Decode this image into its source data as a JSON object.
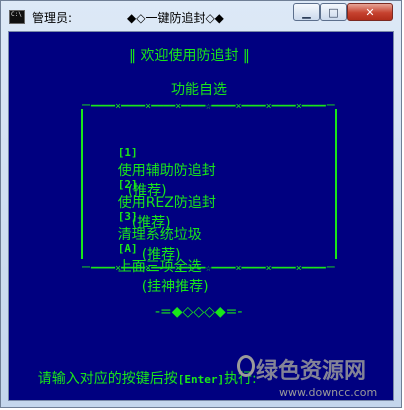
{
  "window": {
    "icon_label": "C:\\",
    "title_left": "管理员:",
    "title_center": "◆◇一键防追封◇◆",
    "controls": {
      "minimize": "▁",
      "maximize": "□",
      "close": "✕"
    }
  },
  "console": {
    "banner": "‖ 欢迎使用防追封 ‖",
    "section_title": "功能自选",
    "rule_top": "ー━━━━×━━━━×━━━━×━━━━☆━━━━×━━━━×━━━━×━━━━ー",
    "rule_bottom": "ー━━━━×━━━━×━━━━×━━━━☆━━━━×━━━━×━━━━×━━━━ー",
    "menu": [
      {
        "key": "[1]",
        "label": "使用辅助防追封",
        "tag": "(推荐)"
      },
      {
        "key": "[2]",
        "label": "使用REZ防追封",
        "tag": "(推荐)"
      },
      {
        "key": "[3]",
        "label": "清理系统垃圾",
        "tag": "(推荐)"
      },
      {
        "key": "[A]",
        "label": "上面三项全选",
        "tag": "(挂神推荐)"
      }
    ],
    "decoration": "-=◆◇◇◇◆=-",
    "prompt_before": "请输入对应的按键后按",
    "prompt_key": "[Enter]",
    "prompt_after": "执行:"
  },
  "watermark": {
    "brand": "绿色资源网",
    "url": "www.downcc.com"
  },
  "colors": {
    "console_bg": "#000080",
    "console_fg": "#19e619",
    "close_button": "#c6422f"
  }
}
